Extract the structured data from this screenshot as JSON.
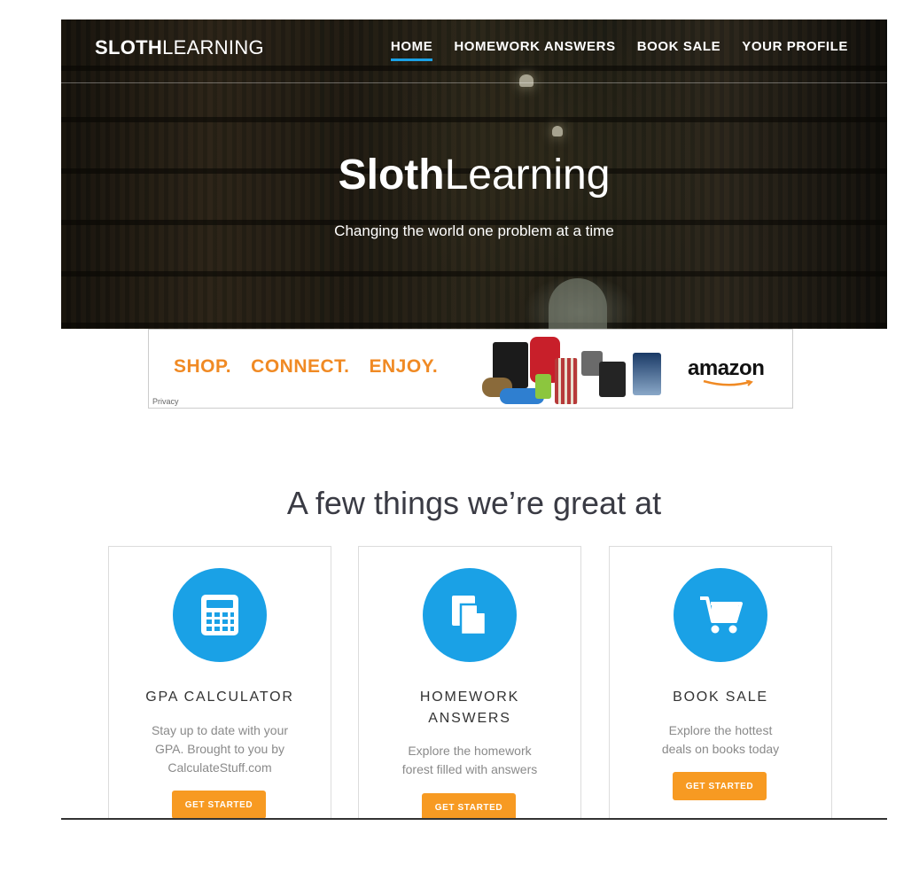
{
  "brand": {
    "bold": "SLOTH",
    "light": "LEARNING"
  },
  "nav": {
    "items": [
      {
        "label": "HOME"
      },
      {
        "label": "HOMEWORK ANSWERS"
      },
      {
        "label": "BOOK SALE"
      },
      {
        "label": "YOUR PROFILE"
      }
    ]
  },
  "hero": {
    "title_bold": "Sloth",
    "title_light": "Learning",
    "subtitle": "Changing the world one problem at a time"
  },
  "ad": {
    "words": [
      "SHOP.",
      "CONNECT.",
      "ENJOY."
    ],
    "logo": "amazon",
    "privacy": "Privacy"
  },
  "section": {
    "title": "A few things we’re great at"
  },
  "cards": [
    {
      "icon": "calculator-icon",
      "title": "GPA CALCULATOR",
      "desc": "Stay up to date with your GPA. Brought to you by CalculateStuff.com",
      "button": "GET STARTED"
    },
    {
      "icon": "documents-icon",
      "title": "HOMEWORK ANSWERS",
      "desc": "Explore the homework forest filled with answers",
      "button": "GET STARTED"
    },
    {
      "icon": "shopping-cart-icon",
      "title": "BOOK SALE",
      "desc": "Explore the hottest deals on books today",
      "button": "GET STARTED"
    }
  ],
  "colors": {
    "accent_blue": "#1aa1e6",
    "button_orange": "#f79a22",
    "ad_orange": "#f08a24",
    "heading": "#3a3b44"
  }
}
